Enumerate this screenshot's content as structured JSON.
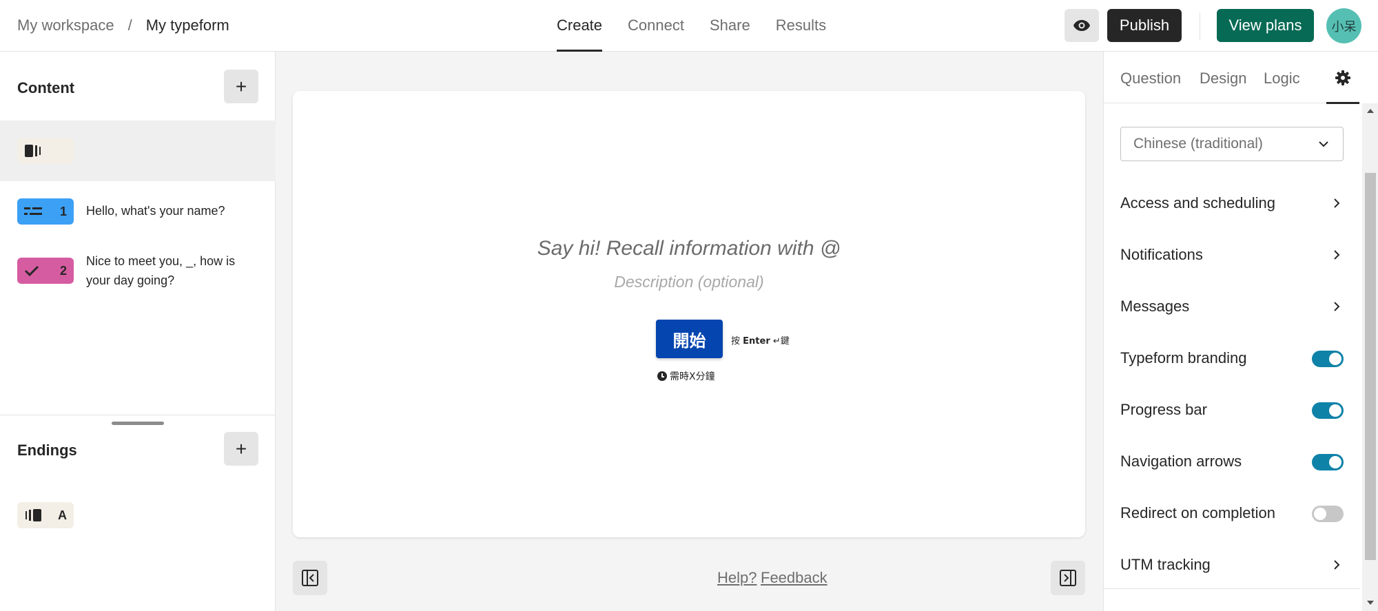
{
  "header": {
    "breadcrumb_workspace": "My workspace",
    "breadcrumb_separator": "/",
    "breadcrumb_form": "My typeform",
    "tabs": [
      {
        "label": "Create",
        "active": true
      },
      {
        "label": "Connect",
        "active": false
      },
      {
        "label": "Share",
        "active": false
      },
      {
        "label": "Results",
        "active": false
      }
    ],
    "publish_label": "Publish",
    "view_plans_label": "View plans",
    "avatar_text": "小呆",
    "preview_icon": "eye-icon"
  },
  "sidebar": {
    "content_title": "Content",
    "add_icon": "plus-icon",
    "welcome_icon": "welcome-screen-icon",
    "questions": [
      {
        "number": "1",
        "text": "Hello, what's your name?",
        "icon": "short-text-icon",
        "color": "#3ca0f5"
      },
      {
        "number": "2",
        "text": "Nice to meet you, _, how is your day going?",
        "icon": "check-icon",
        "color": "#d65ca1"
      }
    ],
    "endings_title": "Endings",
    "ending_letter": "A",
    "ending_icon": "ending-screen-icon"
  },
  "canvas": {
    "title_placeholder": "Say hi! Recall information with @",
    "description_placeholder": "Description (optional)",
    "start_button_label": "開始",
    "enter_prefix": "按",
    "enter_key": "Enter",
    "enter_symbol": "↵",
    "enter_suffix": "鍵",
    "time_text": "需時X分鐘",
    "help_link": "Help?",
    "feedback_link": "Feedback",
    "accent_color": "#0445af"
  },
  "right_panel": {
    "tabs": [
      {
        "label": "Question"
      },
      {
        "label": "Design"
      },
      {
        "label": "Logic"
      }
    ],
    "settings_icon": "gear-icon",
    "language_value": "Chinese (traditional)",
    "settings": [
      {
        "label": "Access and scheduling",
        "kind": "link"
      },
      {
        "label": "Notifications",
        "kind": "link"
      },
      {
        "label": "Messages",
        "kind": "link"
      },
      {
        "label": "Typeform branding",
        "kind": "toggle",
        "on": true
      },
      {
        "label": "Progress bar",
        "kind": "toggle",
        "on": true
      },
      {
        "label": "Navigation arrows",
        "kind": "toggle",
        "on": true
      },
      {
        "label": "Redirect on completion",
        "kind": "toggle",
        "on": false
      },
      {
        "label": "UTM tracking",
        "kind": "link"
      }
    ],
    "toggle_on_color": "#0f82a8"
  }
}
